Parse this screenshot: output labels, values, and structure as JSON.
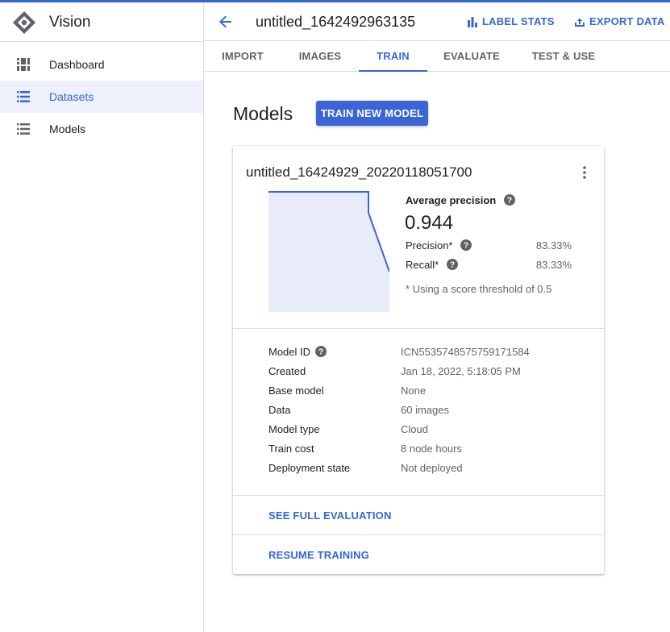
{
  "app": {
    "name": "Vision"
  },
  "sidebar": {
    "items": [
      {
        "label": "Dashboard",
        "icon": "dashboard-icon",
        "active": false
      },
      {
        "label": "Datasets",
        "icon": "list-icon",
        "active": true
      },
      {
        "label": "Models",
        "icon": "list-icon",
        "active": false
      }
    ]
  },
  "header": {
    "title": "untitled_1642492963135",
    "label_stats": "LABEL STATS",
    "export_data": "EXPORT DATA"
  },
  "tabs": [
    {
      "label": "IMPORT",
      "active": false
    },
    {
      "label": "IMAGES",
      "active": false
    },
    {
      "label": "TRAIN",
      "active": true
    },
    {
      "label": "EVALUATE",
      "active": false
    },
    {
      "label": "TEST & USE",
      "active": false
    }
  ],
  "main": {
    "title": "Models",
    "train_button": "TRAIN NEW MODEL"
  },
  "model_card": {
    "name": "untitled_16424929_20220118051700",
    "average_precision_label": "Average precision",
    "average_precision_value": "0.944",
    "precision_label": "Precision*",
    "precision_value": "83.33%",
    "recall_label": "Recall*",
    "recall_value": "83.33%",
    "threshold_note": "* Using a score threshold of 0.5",
    "details": [
      {
        "key": "Model ID",
        "value": "ICN5535748575759171584",
        "help": true
      },
      {
        "key": "Created",
        "value": "Jan 18, 2022, 5:18:05 PM"
      },
      {
        "key": "Base model",
        "value": "None"
      },
      {
        "key": "Data",
        "value": "60 images"
      },
      {
        "key": "Model type",
        "value": "Cloud"
      },
      {
        "key": "Train cost",
        "value": "8 node hours"
      },
      {
        "key": "Deployment state",
        "value": "Not deployed"
      }
    ],
    "see_full_evaluation": "SEE FULL EVALUATION",
    "resume_training": "RESUME TRAINING"
  },
  "colors": {
    "accent": "#3367d6",
    "button": "#3b64d7",
    "chart_fill": "#e8ebf8",
    "chart_line": "#3f64d2"
  }
}
